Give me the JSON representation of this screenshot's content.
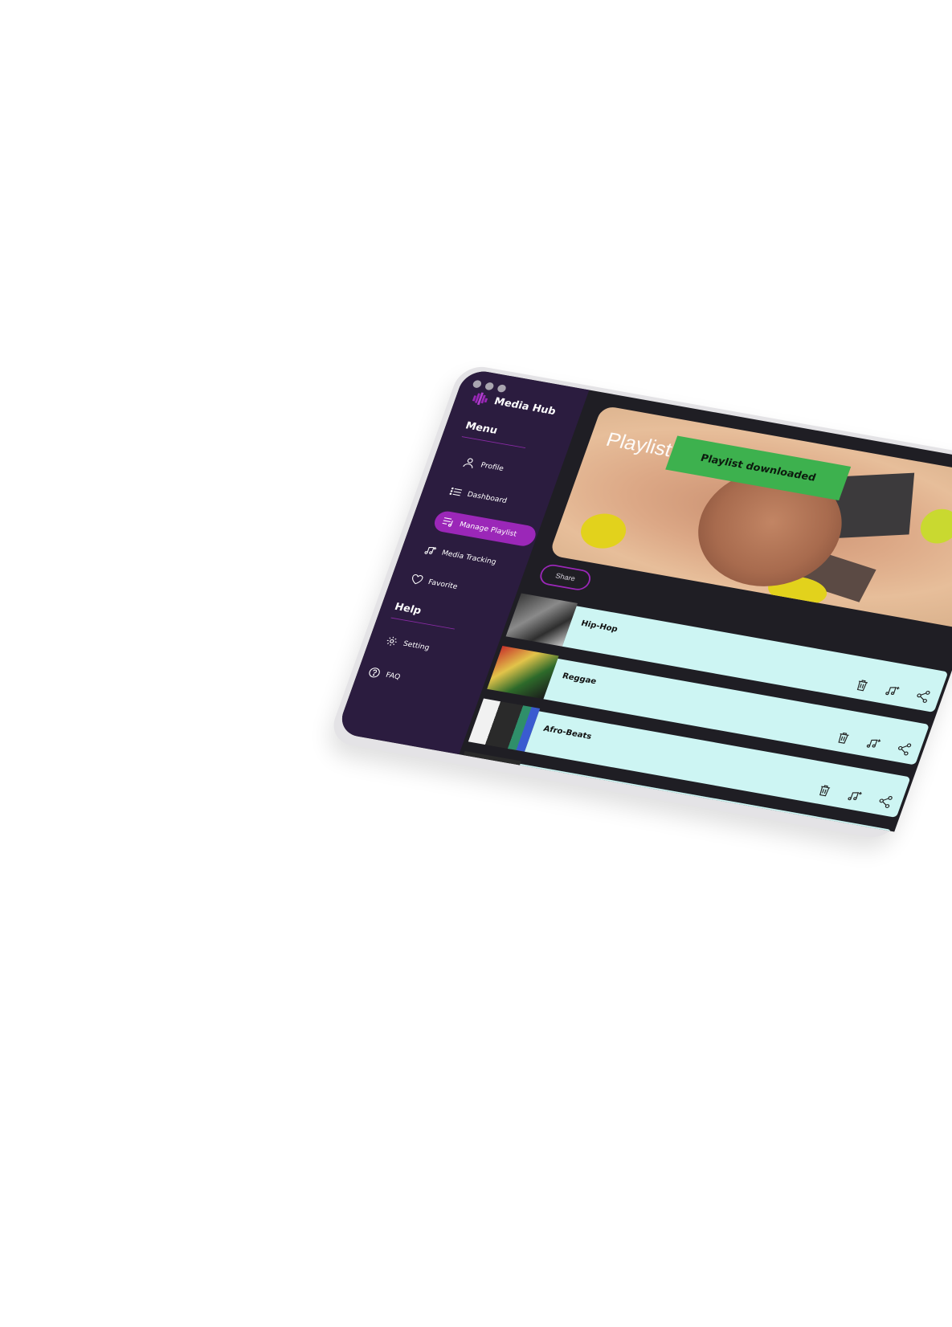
{
  "app": {
    "name": "Media Hub",
    "accent_color": "#9b27b8",
    "sidebar_color": "#2b1c3f"
  },
  "sidebar": {
    "menu_title": "Menu",
    "items": [
      {
        "label": "Profile",
        "icon": "user-icon",
        "active": false
      },
      {
        "label": "Dashboard",
        "icon": "list-icon",
        "active": false
      },
      {
        "label": "Manage Playlist",
        "icon": "playlist-icon",
        "active": true
      },
      {
        "label": "Media Tracking",
        "icon": "music-add-icon",
        "active": false
      },
      {
        "label": "Favorite",
        "icon": "heart-icon",
        "active": false
      }
    ],
    "help_title": "Help",
    "help_items": [
      {
        "label": "Setting",
        "icon": "gear-icon"
      },
      {
        "label": "FAQ",
        "icon": "question-icon"
      }
    ]
  },
  "main": {
    "hero_title": "Playlist",
    "toast": {
      "text": "Playlist downloaded",
      "color": "#3db14e"
    },
    "share_label": "Share",
    "playlists": [
      {
        "genre": "Hip-Hop",
        "actions": [
          "trash-icon",
          "music-add-icon",
          "share-icon"
        ]
      },
      {
        "genre": "Reggae",
        "actions": [
          "trash-icon",
          "music-add-icon",
          "share-icon"
        ]
      },
      {
        "genre": "Afro-Beats",
        "actions": [
          "trash-icon",
          "music-add-icon",
          "share-icon"
        ]
      }
    ]
  }
}
